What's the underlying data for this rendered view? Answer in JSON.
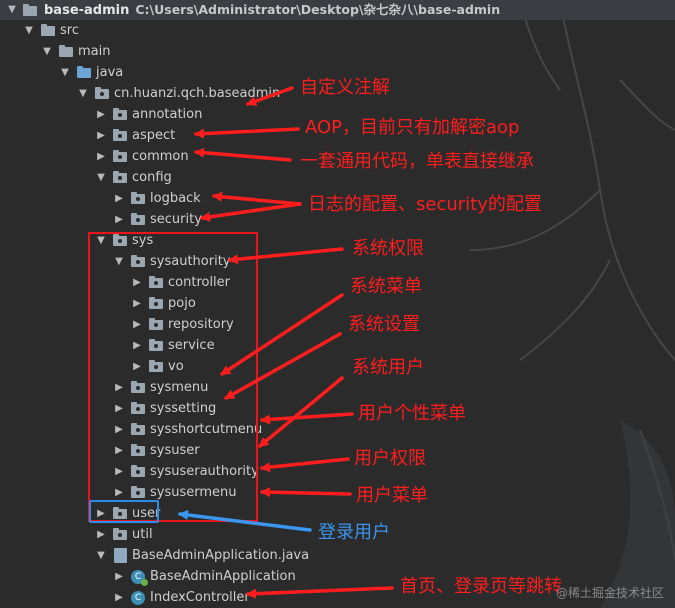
{
  "root": {
    "name": "base-admin",
    "path": "C:\\Users\\Administrator\\Desktop\\杂七杂八\\base-admin"
  },
  "tree": [
    {
      "label": "src",
      "icon": "folder-icon"
    },
    {
      "label": "main",
      "icon": "folder-icon"
    },
    {
      "label": "java",
      "icon": "source-folder-icon"
    },
    {
      "label": "cn.huanzi.qch.baseadmin",
      "icon": "package-icon"
    },
    {
      "label": "annotation",
      "icon": "package-icon"
    },
    {
      "label": "aspect",
      "icon": "package-icon"
    },
    {
      "label": "common",
      "icon": "package-icon"
    },
    {
      "label": "config",
      "icon": "package-icon"
    },
    {
      "label": "logback",
      "icon": "package-icon"
    },
    {
      "label": "security",
      "icon": "package-icon"
    },
    {
      "label": "sys",
      "icon": "package-icon"
    },
    {
      "label": "sysauthority",
      "icon": "package-icon"
    },
    {
      "label": "controller",
      "icon": "package-icon"
    },
    {
      "label": "pojo",
      "icon": "package-icon"
    },
    {
      "label": "repository",
      "icon": "package-icon"
    },
    {
      "label": "service",
      "icon": "package-icon"
    },
    {
      "label": "vo",
      "icon": "package-icon"
    },
    {
      "label": "sysmenu",
      "icon": "package-icon"
    },
    {
      "label": "syssetting",
      "icon": "package-icon"
    },
    {
      "label": "sysshortcutmenu",
      "icon": "package-icon"
    },
    {
      "label": "sysuser",
      "icon": "package-icon"
    },
    {
      "label": "sysuserauthority",
      "icon": "package-icon"
    },
    {
      "label": "sysusermenu",
      "icon": "package-icon"
    },
    {
      "label": "user",
      "icon": "package-icon"
    },
    {
      "label": "util",
      "icon": "package-icon"
    },
    {
      "label": "BaseAdminApplication.java",
      "icon": "java-file-icon"
    },
    {
      "label": "BaseAdminApplication",
      "icon": "spring-class-icon"
    },
    {
      "label": "IndexController",
      "icon": "class-icon"
    }
  ],
  "annotations": [
    {
      "text": "自定义注解",
      "color": "#ff1d1d"
    },
    {
      "text": "AOP，目前只有加解密aop",
      "color": "#ff1d1d"
    },
    {
      "text": "一套通用代码，单表直接继承",
      "color": "#ff1d1d"
    },
    {
      "text": "日志的配置、security的配置",
      "color": "#ff1d1d"
    },
    {
      "text": "系统权限",
      "color": "#ff1d1d"
    },
    {
      "text": "系统菜单",
      "color": "#ff1d1d"
    },
    {
      "text": "系统设置",
      "color": "#ff1d1d"
    },
    {
      "text": "系统用户",
      "color": "#ff1d1d"
    },
    {
      "text": "用户个性菜单",
      "color": "#ff1d1d"
    },
    {
      "text": "用户权限",
      "color": "#ff1d1d"
    },
    {
      "text": "用户菜单",
      "color": "#ff1d1d"
    },
    {
      "text": "登录用户",
      "color": "#3a96f0"
    },
    {
      "text": "首页、登录页等跳转",
      "color": "#ff1d1d"
    }
  ],
  "watermark": "@稀土掘金技术社区",
  "colors": {
    "background": "#2b2b2b",
    "annotation_red": "#ff1d1d",
    "annotation_blue": "#3a96f0",
    "box_red": "#e8161c",
    "box_blue": "#2c8de8"
  }
}
